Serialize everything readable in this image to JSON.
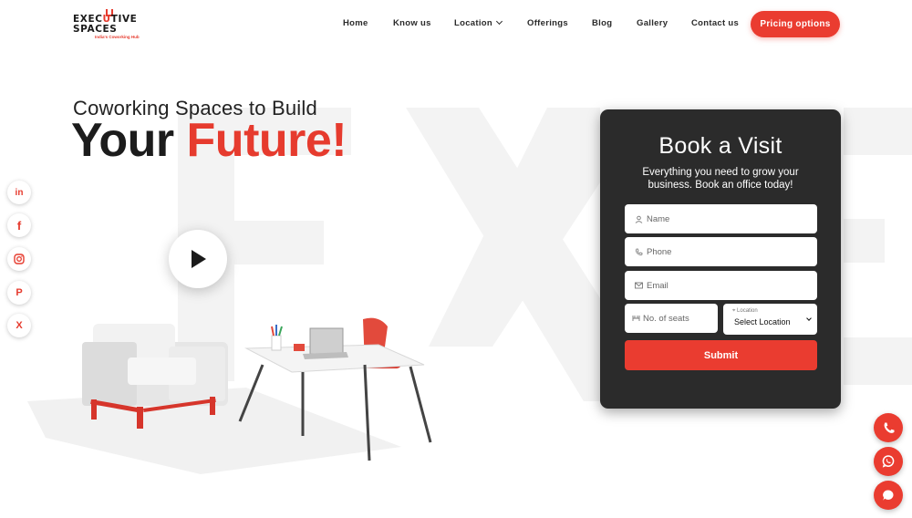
{
  "brand": {
    "line1_a": "EXEC",
    "line1_b": "TIVE",
    "line2": "SPACES",
    "tagline": "India's Coworking Hub"
  },
  "nav": {
    "items": [
      {
        "label": "Home"
      },
      {
        "label": "Know us"
      },
      {
        "label": "Location"
      },
      {
        "label": "Offerings"
      },
      {
        "label": "Blog"
      },
      {
        "label": "Gallery"
      },
      {
        "label": "Contact us"
      }
    ],
    "cta": "Pricing options"
  },
  "hero": {
    "subtitle": "Coworking Spaces to Build",
    "title_dark": "Your",
    "title_red": "Future!"
  },
  "social": [
    {
      "icon": "linkedin-icon",
      "glyph": "in"
    },
    {
      "icon": "facebook-icon",
      "glyph": "f"
    },
    {
      "icon": "instagram-icon",
      "glyph": ""
    },
    {
      "icon": "pinterest-icon",
      "glyph": "P"
    },
    {
      "icon": "x-icon",
      "glyph": "X"
    }
  ],
  "booking": {
    "title": "Book a Visit",
    "description": "Everything you need to grow your business. Book an office today!",
    "name_placeholder": "Name",
    "phone_placeholder": "Phone",
    "email_placeholder": "Email",
    "seats_placeholder": "No. of seats",
    "location_label": "Location",
    "location_value": "Select Location",
    "submit_label": "Submit"
  },
  "colors": {
    "accent": "#ea3c30",
    "card": "#2b2b2b",
    "text_dark": "#1c1c1c"
  }
}
